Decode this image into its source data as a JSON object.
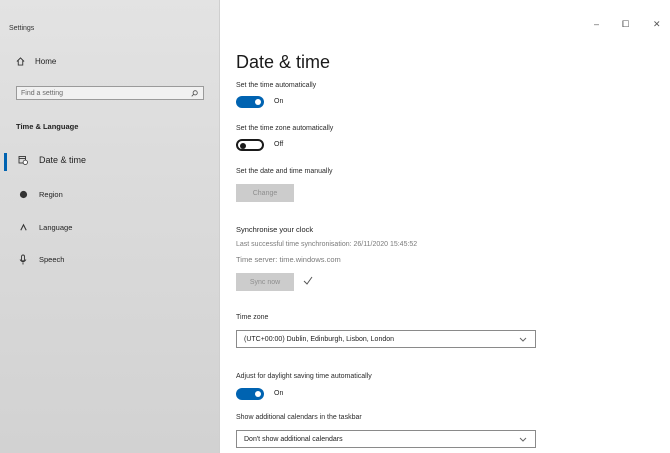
{
  "window": {
    "title": "Settings",
    "minimize_glyph": "–",
    "restore_glyph": "⧠",
    "close_glyph": "✕"
  },
  "sidebar": {
    "home_label": "Home",
    "search_placeholder": "Find a setting",
    "section_title": "Time & Language",
    "items": [
      {
        "label": "Date & time",
        "icon": "calendar-clock-icon",
        "selected": true
      },
      {
        "label": "Region",
        "icon": "globe-icon"
      },
      {
        "label": "Language",
        "icon": "language-icon"
      },
      {
        "label": "Speech",
        "icon": "microphone-icon"
      }
    ]
  },
  "main": {
    "title": "Date & time",
    "set_time_auto": {
      "label": "Set the time automatically",
      "state": "On"
    },
    "set_zone_auto": {
      "label": "Set the time zone automatically",
      "state": "Off"
    },
    "manual": {
      "label": "Set the date and time manually",
      "button": "Change"
    },
    "sync": {
      "heading": "Synchronise your clock",
      "last_sync": "Last successful time synchronisation: 26/11/2020 15:45:52",
      "server": "Time server: time.windows.com",
      "button": "Sync now",
      "status_icon": "checkmark-icon"
    },
    "timezone": {
      "label": "Time zone",
      "value": "(UTC+00:00) Dublin, Edinburgh, Lisbon, London"
    },
    "dst": {
      "label": "Adjust for daylight saving time automatically",
      "state": "On"
    },
    "calendars": {
      "label": "Show additional calendars in the taskbar",
      "value": "Don't show additional calendars"
    }
  },
  "colors": {
    "accent": "#0063b1",
    "disabled_button": "#cccccc"
  }
}
